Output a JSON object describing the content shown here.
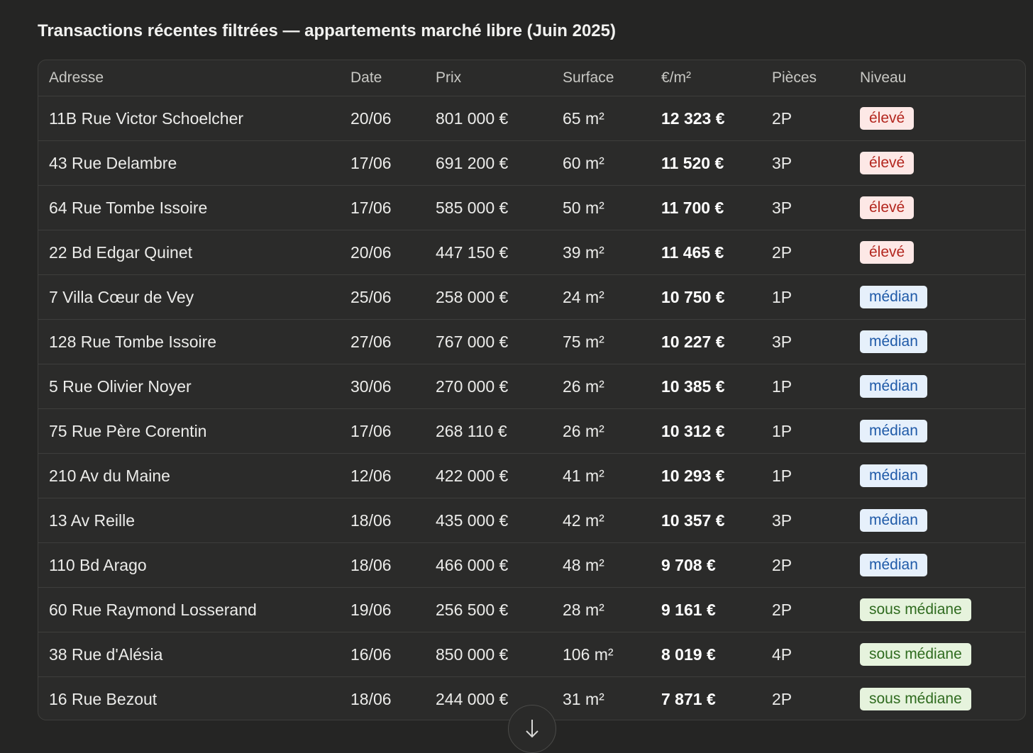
{
  "title": "Transactions récentes filtrées — appartements marché libre (Juin 2025)",
  "columns": [
    "Adresse",
    "Date",
    "Prix",
    "Surface",
    "€/m²",
    "Pièces",
    "Niveau"
  ],
  "rows": [
    {
      "adresse": "11B Rue Victor Schoelcher",
      "date": "20/06",
      "prix": "801 000 €",
      "surface": "65 m²",
      "ppm": "12 323 €",
      "pieces": "2P",
      "niveau": "élevé",
      "level": "high"
    },
    {
      "adresse": "43 Rue Delambre",
      "date": "17/06",
      "prix": "691 200 €",
      "surface": "60 m²",
      "ppm": "11 520 €",
      "pieces": "3P",
      "niveau": "élevé",
      "level": "high"
    },
    {
      "adresse": "64 Rue Tombe Issoire",
      "date": "17/06",
      "prix": "585 000 €",
      "surface": "50 m²",
      "ppm": "11 700 €",
      "pieces": "3P",
      "niveau": "élevé",
      "level": "high"
    },
    {
      "adresse": "22 Bd Edgar Quinet",
      "date": "20/06",
      "prix": "447 150 €",
      "surface": "39 m²",
      "ppm": "11 465 €",
      "pieces": "2P",
      "niveau": "élevé",
      "level": "high"
    },
    {
      "adresse": "7 Villa Cœur de Vey",
      "date": "25/06",
      "prix": "258 000 €",
      "surface": "24 m²",
      "ppm": "10 750 €",
      "pieces": "1P",
      "niveau": "médian",
      "level": "median"
    },
    {
      "adresse": "128 Rue Tombe Issoire",
      "date": "27/06",
      "prix": "767 000 €",
      "surface": "75 m²",
      "ppm": "10 227 €",
      "pieces": "3P",
      "niveau": "médian",
      "level": "median"
    },
    {
      "adresse": "5 Rue Olivier Noyer",
      "date": "30/06",
      "prix": "270 000 €",
      "surface": "26 m²",
      "ppm": "10 385 €",
      "pieces": "1P",
      "niveau": "médian",
      "level": "median"
    },
    {
      "adresse": "75 Rue Père Corentin",
      "date": "17/06",
      "prix": "268 110 €",
      "surface": "26 m²",
      "ppm": "10 312 €",
      "pieces": "1P",
      "niveau": "médian",
      "level": "median"
    },
    {
      "adresse": "210 Av du Maine",
      "date": "12/06",
      "prix": "422 000 €",
      "surface": "41 m²",
      "ppm": "10 293 €",
      "pieces": "1P",
      "niveau": "médian",
      "level": "median"
    },
    {
      "adresse": "13 Av Reille",
      "date": "18/06",
      "prix": "435 000 €",
      "surface": "42 m²",
      "ppm": "10 357 €",
      "pieces": "3P",
      "niveau": "médian",
      "level": "median"
    },
    {
      "adresse": "110 Bd Arago",
      "date": "18/06",
      "prix": "466 000 €",
      "surface": "48 m²",
      "ppm": "9 708 €",
      "pieces": "2P",
      "niveau": "médian",
      "level": "median"
    },
    {
      "adresse": "60 Rue Raymond Losserand",
      "date": "19/06",
      "prix": "256 500 €",
      "surface": "28 m²",
      "ppm": "9 161 €",
      "pieces": "2P",
      "niveau": "sous médiane",
      "level": "low"
    },
    {
      "adresse": "38 Rue d'Alésia",
      "date": "16/06",
      "prix": "850 000 €",
      "surface": "106 m²",
      "ppm": "8 019 €",
      "pieces": "4P",
      "niveau": "sous médiane",
      "level": "low"
    },
    {
      "adresse": "16 Rue Bezout",
      "date": "18/06",
      "prix": "244 000 €",
      "surface": "31 m²",
      "ppm": "7 871 €",
      "pieces": "2P",
      "niveau": "sous médiane",
      "level": "low"
    }
  ],
  "icons": {
    "scroll_down": "arrow-down-icon"
  },
  "colors": {
    "background": "#252524",
    "badge_high_bg": "#fde8e6",
    "badge_high_text": "#b3261e",
    "badge_median_bg": "#e6f0fb",
    "badge_median_text": "#1f5aa8",
    "badge_low_bg": "#e6f3dd",
    "badge_low_text": "#2f6b1f"
  }
}
